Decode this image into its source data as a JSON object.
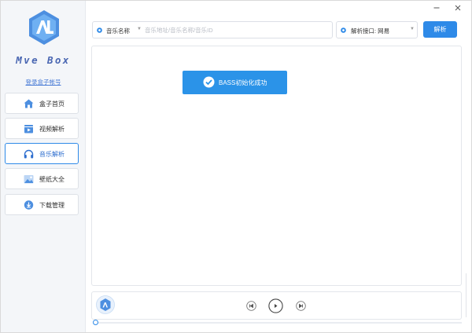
{
  "app": {
    "brand": "Mve Box",
    "login_link": "登录盒子帐号"
  },
  "sidebar": {
    "items": [
      {
        "label": "盒子首页",
        "icon": "home-icon",
        "active": false
      },
      {
        "label": "视频解析",
        "icon": "video-icon",
        "active": false
      },
      {
        "label": "音乐解析",
        "icon": "headphones-icon",
        "active": true
      },
      {
        "label": "壁纸大全",
        "icon": "image-icon",
        "active": false
      },
      {
        "label": "下载管理",
        "icon": "download-icon",
        "active": false
      }
    ]
  },
  "search": {
    "source_label": "音乐名称",
    "placeholder": "音乐地址/音乐名称/音乐ID",
    "value": "",
    "api_label": "解析接口: 网易",
    "button_label": "解析"
  },
  "toast": {
    "message": "BASS初始化成功",
    "icon": "check-circle-icon"
  },
  "player": {
    "progress": 0
  },
  "colors": {
    "accent": "#2e8ae8",
    "brand_text": "#4a67b2",
    "toast_bg": "#2b93e8"
  }
}
